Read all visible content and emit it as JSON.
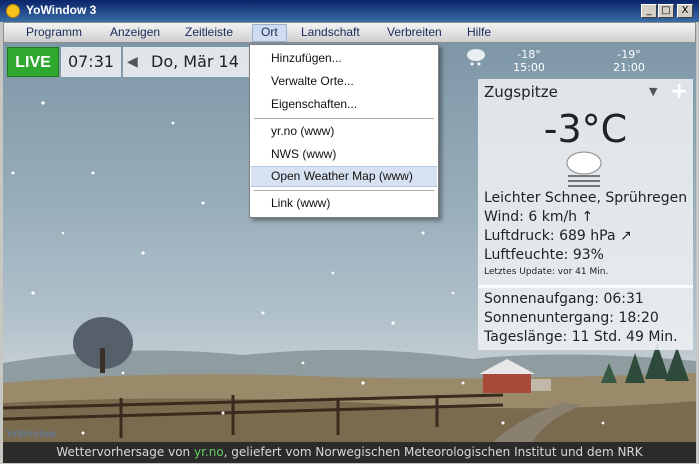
{
  "window": {
    "title": "YoWindow 3",
    "buttons": [
      "_",
      "□",
      "X"
    ]
  },
  "menubar": {
    "items": [
      "Programm",
      "Anzeigen",
      "Zeitleiste",
      "Ort",
      "Landschaft",
      "Verbreiten",
      "Hilfe"
    ],
    "active": "Ort"
  },
  "timeline": {
    "live_label": "LIVE",
    "time": "07:31",
    "date": "Do, Mär 14",
    "forecast": [
      {
        "temp": "-18°",
        "time": "15:00"
      },
      {
        "temp": "-19°",
        "time": "21:00"
      }
    ]
  },
  "dropdown": {
    "items": [
      "Hinzufügen...",
      "Verwalte Orte...",
      "Eigenschaften...",
      "yr.no (www)",
      "NWS (www)",
      "Open Weather Map (www)",
      "Link (www)"
    ],
    "highlighted": "Open Weather Map (www)"
  },
  "weather": {
    "location": "Zugspitze",
    "temperature": "-3°C",
    "description": "Leichter Schnee, Sprühregen",
    "wind_label": "Wind:",
    "wind_value": "6 km/h",
    "pressure_label": "Luftdruck:",
    "pressure_value": "689 hPa",
    "humidity_label": "Luftfeuchte:",
    "humidity_value": "93%",
    "update_label": "Letztes Update:",
    "update_value": "vor 41 Min.",
    "sunrise_label": "Sonnenaufgang:",
    "sunrise_value": "06:31",
    "sunset_label": "Sonnenuntergang:",
    "sunset_value": "18:20",
    "daylength_label": "Tageslänge:",
    "daylength_value": "11 Std. 49 Min."
  },
  "brand": "YoWindow",
  "footer": {
    "prefix": "Wettervorhersage von ",
    "source": "yr.no",
    "suffix": ", geliefert vom Norwegischen Meteorologischen Institut und dem NRK"
  },
  "colors": {
    "live": "#2fa82f",
    "titlebar": "#0a246a",
    "footer_link": "#66cc66"
  }
}
